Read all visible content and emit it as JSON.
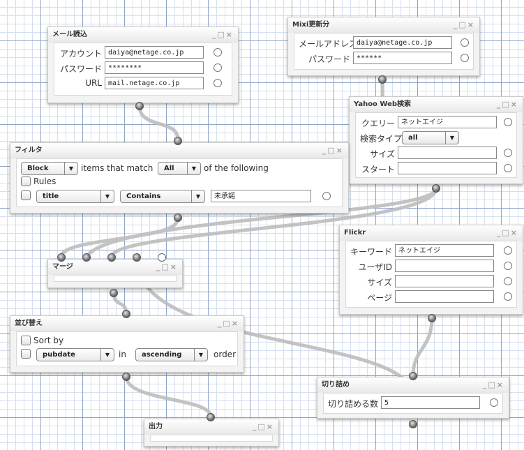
{
  "window_controls": {
    "minimize": "_",
    "maximize": "□",
    "close": "×"
  },
  "mail": {
    "title": "メール読込",
    "fields": [
      {
        "label": "アカウント",
        "value": "daiya@netage.co.jp"
      },
      {
        "label": "パスワード",
        "value": "********"
      },
      {
        "label": "URL",
        "value": "mail.netage.co.jp"
      }
    ]
  },
  "mixi": {
    "title": "Mixi更新分",
    "fields": [
      {
        "label": "メールアドレス",
        "value": "daiya@netage.co.jp"
      },
      {
        "label": "パスワード",
        "value": "******"
      }
    ]
  },
  "yahoo": {
    "title": "Yahoo Web検索",
    "query_label": "クエリー",
    "query_value": "ネットエイジ",
    "type_label": "検索タイプ",
    "type_value": "all",
    "size_label": "サイズ",
    "size_value": "",
    "start_label": "スタート",
    "start_value": ""
  },
  "filter": {
    "title": "フィルタ",
    "mode": "Block",
    "text1": "items that match",
    "match": "All",
    "text2": "of the following",
    "rules_label": "Rules",
    "rule_field": "title",
    "rule_op": "Contains",
    "rule_value": "未承諾"
  },
  "flickr": {
    "title": "Flickr",
    "fields": [
      {
        "label": "キーワード",
        "value": "ネットエイジ"
      },
      {
        "label": "ユーザID",
        "value": ""
      },
      {
        "label": "サイズ",
        "value": ""
      },
      {
        "label": "ページ",
        "value": ""
      }
    ]
  },
  "merge": {
    "title": "マージ"
  },
  "sort": {
    "title": "並び替え",
    "sortby_label": "Sort by",
    "field": "pubdate",
    "in_label": "in",
    "direction": "ascending",
    "order_label": "order"
  },
  "truncate": {
    "title": "切り詰め",
    "count_label": "切り詰める数",
    "count_value": "5"
  },
  "output": {
    "title": "出力"
  }
}
